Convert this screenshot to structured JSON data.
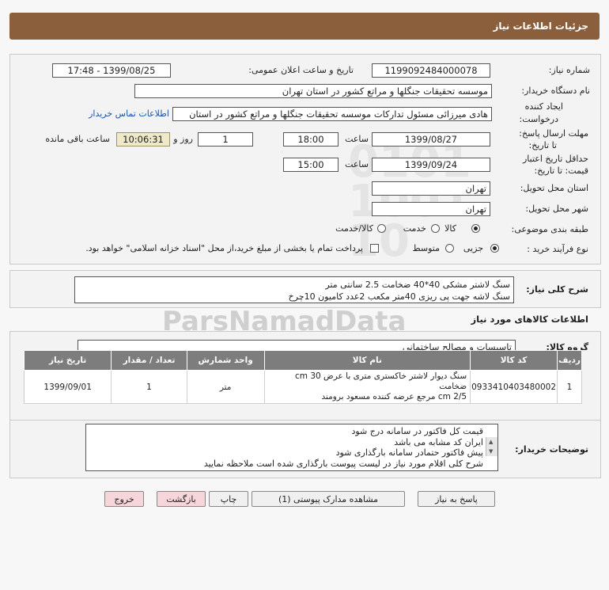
{
  "header": {
    "title": "جزئیات اطلاعات نیاز"
  },
  "form": {
    "need_number_label": "شماره نیاز:",
    "need_number": "1199092484000078",
    "announce_label": "تاریخ و ساعت اعلان عمومی:",
    "announce_value": "1399/08/25 - 17:48",
    "buyer_org_label": "نام دستگاه خریدار:",
    "buyer_org": "موسسه تحقیقات جنگلها و مراتع کشور در استان تهران",
    "creator_label_1": "ایجاد کننده",
    "creator_label_2": "درخواست:",
    "creator": "هادی میرزائی مسئول تدارکات موسسه تحقیقات جنگلها و مراتع کشور در استان",
    "contact_link": "اطلاعات تماس خریدار",
    "deadline_label_1": "مهلت ارسال پاسخ:",
    "deadline_label_2": "تا تاریخ:",
    "deadline_date": "1399/08/27",
    "time_label": "ساعت",
    "deadline_time": "18:00",
    "days_value": "1",
    "days_label": "روز و",
    "remaining_time": "10:06:31",
    "remaining_label": "ساعت باقی مانده",
    "validity_label_1": "حداقل تاریخ اعتبار",
    "validity_label_2": "قیمت: تا تاریخ:",
    "validity_date": "1399/09/24",
    "validity_time": "15:00",
    "province_label": "استان محل تحویل:",
    "province": "تهران",
    "city_label": "شهر محل تحویل:",
    "city": "تهران",
    "category_label": "طبقه بندی موضوعی:",
    "category_options": [
      "کالا",
      "خدمت",
      "کالا/خدمت"
    ],
    "process_label": "نوع فرآیند خرید :",
    "process_options": [
      "جزیی",
      "متوسط"
    ],
    "payment_note": "پرداخت تمام یا بخشی از مبلغ خرید،از محل \"اسناد خزانه اسلامی\" خواهد بود."
  },
  "summary": {
    "label": "شرح کلی نیاز:",
    "lines": [
      "سنگ لاشتر مشکی 40*40 ضخامت 2.5 سانتی متر",
      "سنگ لاشه جهت پی ریزی 40متر مکعب 2عدد کامیون 10چرخ"
    ]
  },
  "goods": {
    "section_title": "اطلاعات کالاهای مورد نیاز",
    "group_label": "گروه کالا:",
    "group_value": "تاسیسات و مصالح ساختمانی",
    "columns": [
      "ردیف",
      "کد کالا",
      "نام کالا",
      "واحد شمارش",
      "تعداد / مقدار",
      "تاریخ نیاز"
    ],
    "rows": [
      {
        "idx": "1",
        "code": "0933410403480002",
        "name_1": "سنگ دیوار لاشتر خاکستری متری با عرض cm 30 ضخامت",
        "name_2": "cm 2/5 مرجع عرضه کننده مسعود برومند",
        "unit": "متر",
        "qty": "1",
        "date": "1399/09/01"
      }
    ]
  },
  "buyer_notes": {
    "label": "توضیحات خریدار:",
    "lines": [
      "قیمت کل فاکتور در سامانه درج شود",
      "ایران کد مشابه می باشد",
      "پیش فاکتور حتمادر سامانه بارگذاری شود",
      "شرح کلی اقلام مورد نیاز در لیست پیوست بارگذاری شده است ملاحظه نمایید"
    ]
  },
  "buttons": {
    "reply": "پاسخ به نیاز",
    "attachments": "مشاهده مدارک پیوستی (1)",
    "print": "چاپ",
    "back": "بازگشت",
    "exit": "خروج"
  },
  "watermark": {
    "brand": "ParsNamadData"
  }
}
